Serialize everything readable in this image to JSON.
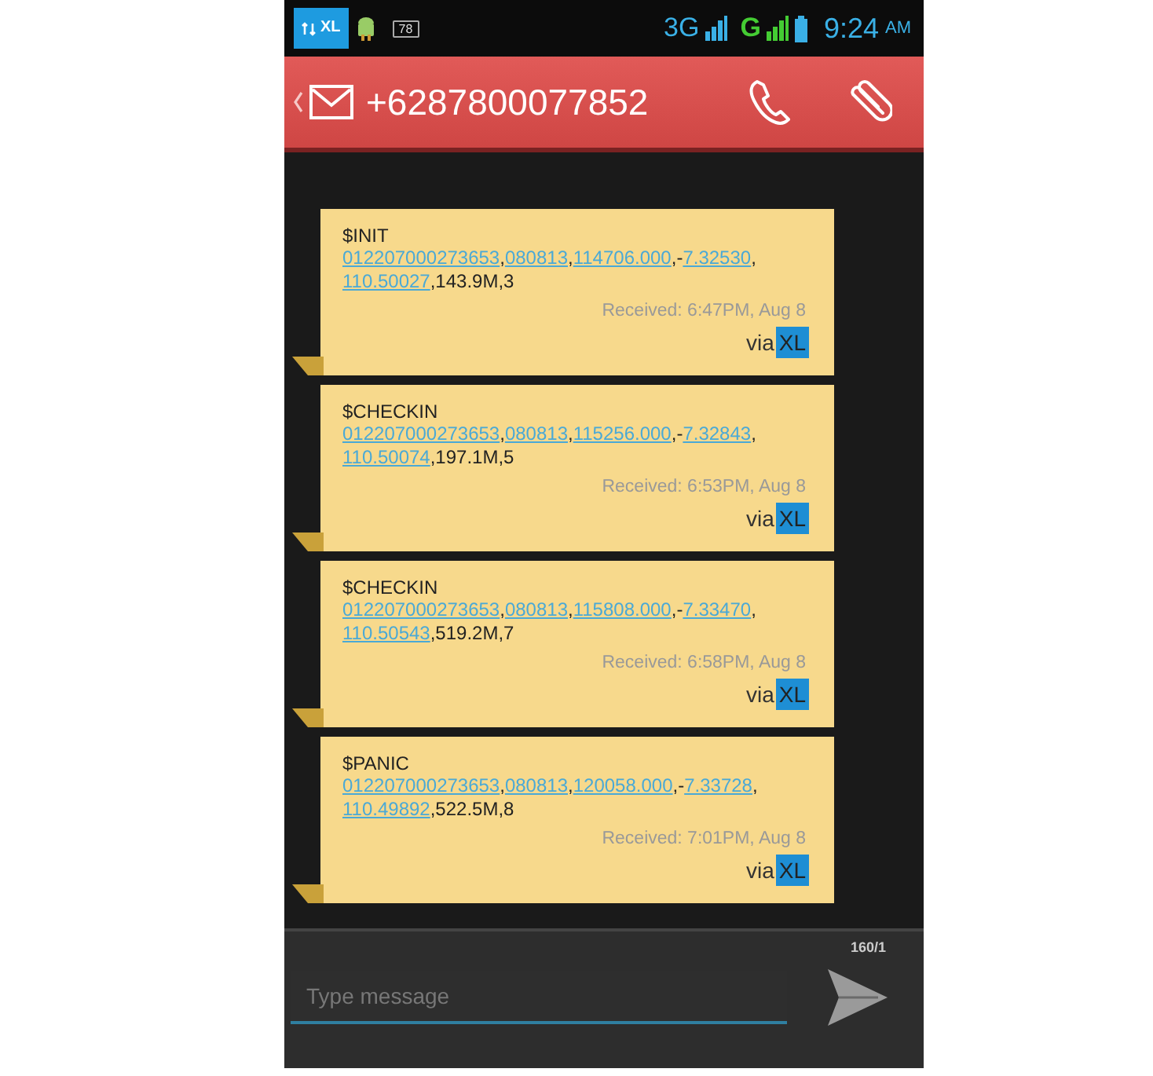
{
  "status_bar": {
    "carrier_badge": "XL",
    "battery_badge": "78",
    "network_1": "3G",
    "network_2": "G",
    "time": "9:24",
    "meridiem": "AM"
  },
  "header": {
    "contact": "+6287800077852"
  },
  "messages": [
    {
      "title": "$INIT",
      "lines": [
        [
          {
            "text": "012207000273653",
            "link": true
          },
          {
            "text": ",",
            "link": false
          },
          {
            "text": "080813",
            "link": true
          },
          {
            "text": ",",
            "link": false
          },
          {
            "text": "114706.000",
            "link": true
          },
          {
            "text": ",-",
            "link": false
          },
          {
            "text": "7.32530",
            "link": true
          },
          {
            "text": ",",
            "link": false
          }
        ],
        [
          {
            "text": "110.50027",
            "link": true
          },
          {
            "text": ",143.9M,3",
            "link": false
          }
        ]
      ],
      "received": "Received: 6:47PM, Aug 8",
      "via": "via",
      "carrier": "XL"
    },
    {
      "title": "$CHECKIN",
      "lines": [
        [
          {
            "text": "012207000273653",
            "link": true
          },
          {
            "text": ",",
            "link": false
          },
          {
            "text": "080813",
            "link": true
          },
          {
            "text": ",",
            "link": false
          },
          {
            "text": "115256.000",
            "link": true
          },
          {
            "text": ",-",
            "link": false
          },
          {
            "text": "7.32843",
            "link": true
          },
          {
            "text": ",",
            "link": false
          }
        ],
        [
          {
            "text": "110.50074",
            "link": true
          },
          {
            "text": ",197.1M,5",
            "link": false
          }
        ]
      ],
      "received": "Received: 6:53PM, Aug 8",
      "via": "via",
      "carrier": "XL"
    },
    {
      "title": "$CHECKIN",
      "lines": [
        [
          {
            "text": "012207000273653",
            "link": true
          },
          {
            "text": ",",
            "link": false
          },
          {
            "text": "080813",
            "link": true
          },
          {
            "text": ",",
            "link": false
          },
          {
            "text": "115808.000",
            "link": true
          },
          {
            "text": ",-",
            "link": false
          },
          {
            "text": "7.33470",
            "link": true
          },
          {
            "text": ",",
            "link": false
          }
        ],
        [
          {
            "text": "110.50543",
            "link": true
          },
          {
            "text": ",519.2M,7",
            "link": false
          }
        ]
      ],
      "received": "Received: 6:58PM, Aug 8",
      "via": "via",
      "carrier": "XL"
    },
    {
      "title": "$PANIC",
      "lines": [
        [
          {
            "text": "012207000273653",
            "link": true
          },
          {
            "text": ",",
            "link": false
          },
          {
            "text": "080813",
            "link": true
          },
          {
            "text": ",",
            "link": false
          },
          {
            "text": "120058.000",
            "link": true
          },
          {
            "text": ",-",
            "link": false
          },
          {
            "text": "7.33728",
            "link": true
          },
          {
            "text": ",",
            "link": false
          }
        ],
        [
          {
            "text": "110.49892",
            "link": true
          },
          {
            "text": ",522.5M,8",
            "link": false
          }
        ]
      ],
      "received": "Received: 7:01PM, Aug 8",
      "via": "via",
      "carrier": "XL"
    }
  ],
  "composer": {
    "counter": "160/1",
    "placeholder": "Type message"
  }
}
